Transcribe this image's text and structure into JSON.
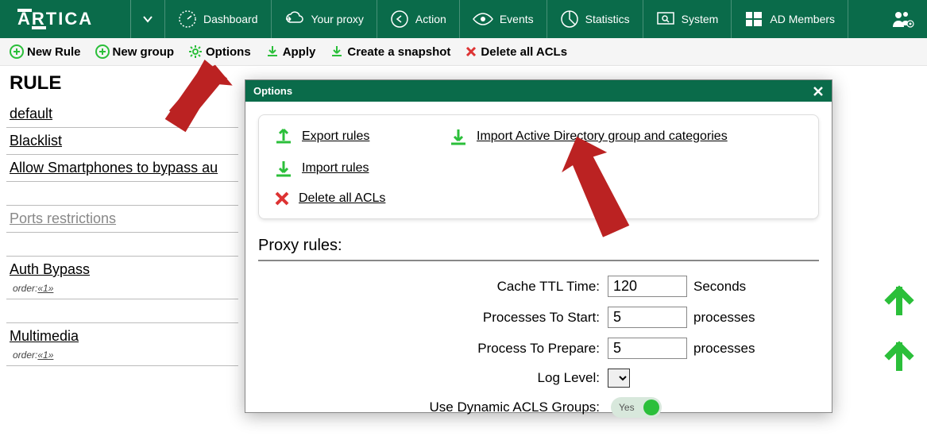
{
  "nav": {
    "dashboard": "Dashboard",
    "proxy": "Your proxy",
    "action": "Action",
    "events": "Events",
    "statistics": "Statistics",
    "system": "System",
    "ad_members": "AD Members"
  },
  "toolbar": {
    "new_rule": "New Rule",
    "new_group": "New group",
    "options": "Options",
    "apply": "Apply",
    "snapshot": "Create a snapshot",
    "delete_all": "Delete all ACLs"
  },
  "rules": {
    "heading": "RULE",
    "items": [
      "default",
      "Blacklist",
      "Allow Smartphones to bypass au"
    ],
    "ports": "Ports restrictions",
    "auth_bypass": "Auth Bypass",
    "multimedia": "Multimedia",
    "order_label": "order:",
    "order_value": "«1»"
  },
  "modal": {
    "title": "Options",
    "export": "Export rules",
    "import": "Import rules",
    "delete": "Delete all ACLs",
    "import_ad": "Import Active Directory group and categories",
    "proxy_heading": "Proxy rules:",
    "fields": {
      "cache_ttl_label": "Cache TTL Time:",
      "cache_ttl_value": "120",
      "cache_ttl_unit": "Seconds",
      "proc_start_label": "Processes To Start:",
      "proc_start_value": "5",
      "proc_start_unit": "processes",
      "proc_prepare_label": "Process To Prepare:",
      "proc_prepare_value": "5",
      "proc_prepare_unit": "processes",
      "log_level_label": "Log Level:",
      "dyn_acls_label": "Use Dynamic ACLS Groups:",
      "dyn_acls_value": "Yes"
    }
  }
}
